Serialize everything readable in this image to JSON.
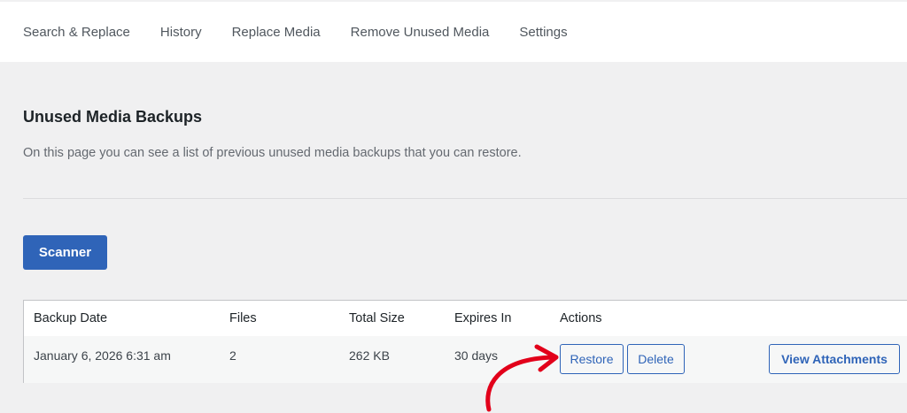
{
  "nav": {
    "tabs": [
      {
        "label": "Search & Replace"
      },
      {
        "label": "History"
      },
      {
        "label": "Replace Media"
      },
      {
        "label": "Remove Unused Media"
      },
      {
        "label": "Settings"
      }
    ]
  },
  "page": {
    "title": "Unused Media Backups",
    "description": "On this page you can see a list of previous unused media backups that you can restore."
  },
  "scanner_button": {
    "label": "Scanner"
  },
  "table": {
    "columns": [
      "Backup Date",
      "Files",
      "Total Size",
      "Expires In",
      "Actions"
    ],
    "rows": [
      {
        "backup_date": "January 6, 2026 6:31 am",
        "files": "2",
        "total_size": "262 KB",
        "expires_in": "30 days",
        "restore_label": "Restore",
        "delete_label": "Delete",
        "view_label": "View Attachments"
      }
    ]
  },
  "colors": {
    "accent": "#2f64b8",
    "annotation_arrow": "#e2001a"
  },
  "icons": {
    "annotation": "curved-arrow-icon"
  }
}
